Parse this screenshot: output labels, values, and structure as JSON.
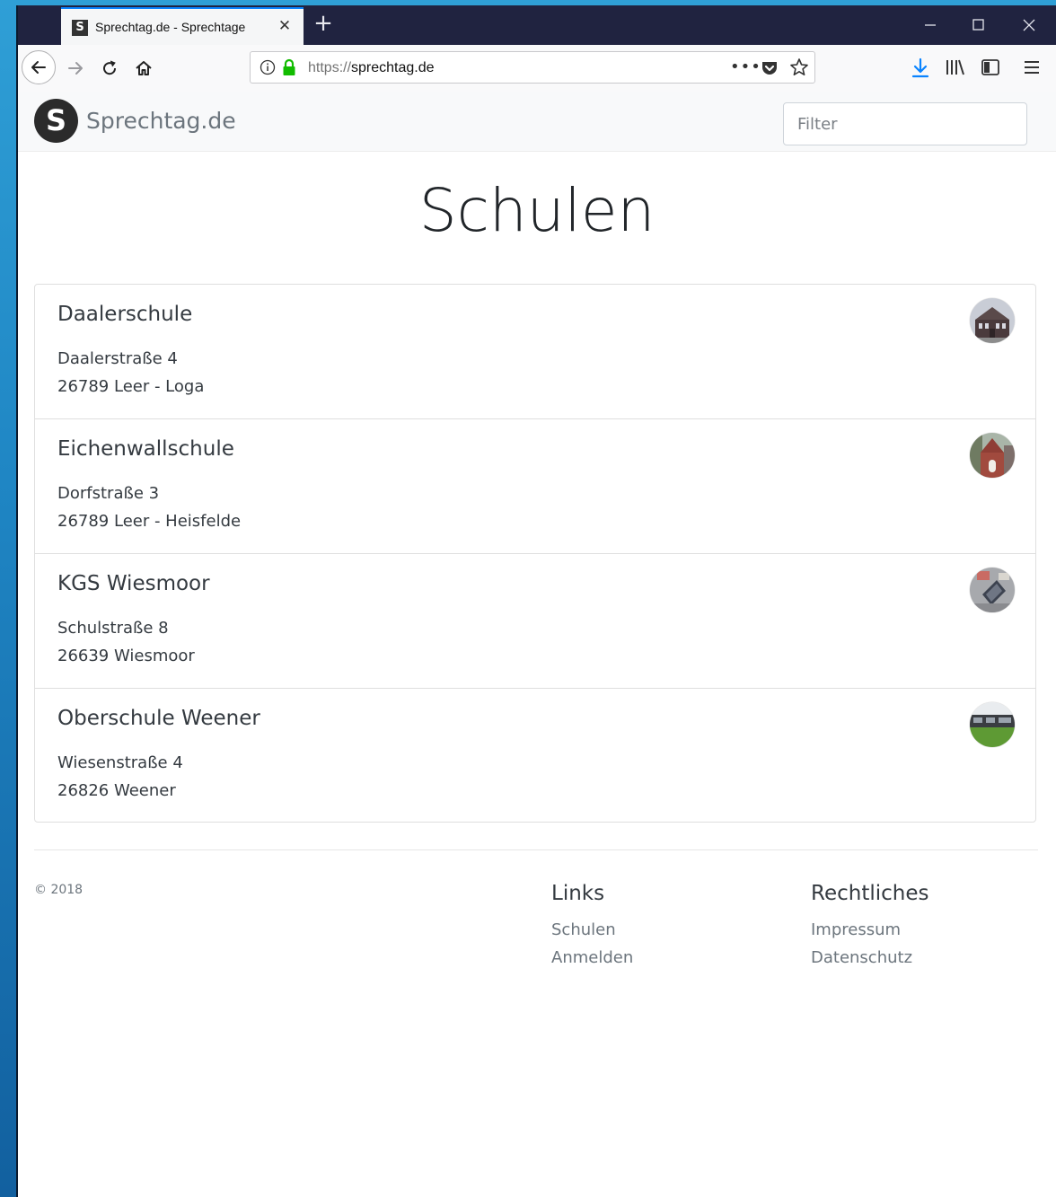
{
  "browser": {
    "tab": {
      "favicon_letter": "S",
      "title": "Sprechtag.de - Sprechtage"
    },
    "url": {
      "scheme": "https://",
      "host": "sprechtag.de"
    },
    "icons": {
      "tab_close": "close-icon",
      "new_tab": "plus-icon",
      "back": "arrow-left-icon",
      "forward": "arrow-right-icon",
      "reload": "reload-icon",
      "home": "home-icon",
      "info": "info-icon",
      "lock": "lock-icon",
      "more": "ellipsis-icon",
      "pocket": "pocket-icon",
      "bookmark": "star-icon",
      "download": "download-icon",
      "library": "library-icon",
      "sidebar": "sidebar-icon",
      "menu": "hamburger-icon"
    },
    "colors": {
      "lock": "#12bc00",
      "download": "#0a84ff",
      "tab_strip": "#202340"
    }
  },
  "header": {
    "logo_letter": "S",
    "brand": "Sprechtag.de",
    "filter_placeholder": "Filter"
  },
  "main": {
    "title": "Schulen",
    "schools": [
      {
        "name": "Daalerschule",
        "street": "Daalerstraße 4",
        "city": "26789 Leer - Loga"
      },
      {
        "name": "Eichenwallschule",
        "street": "Dorfstraße 3",
        "city": "26789 Leer - Heisfelde"
      },
      {
        "name": "KGS Wiesmoor",
        "street": "Schulstraße 8",
        "city": "26639 Wiesmoor"
      },
      {
        "name": "Oberschule Weener",
        "street": "Wiesenstraße 4",
        "city": "26826 Weener"
      }
    ]
  },
  "footer": {
    "copyright": "© 2018",
    "links": {
      "heading": "Links",
      "items": [
        "Schulen",
        "Anmelden"
      ]
    },
    "legal": {
      "heading": "Rechtliches",
      "items": [
        "Impressum",
        "Datenschutz"
      ]
    }
  }
}
